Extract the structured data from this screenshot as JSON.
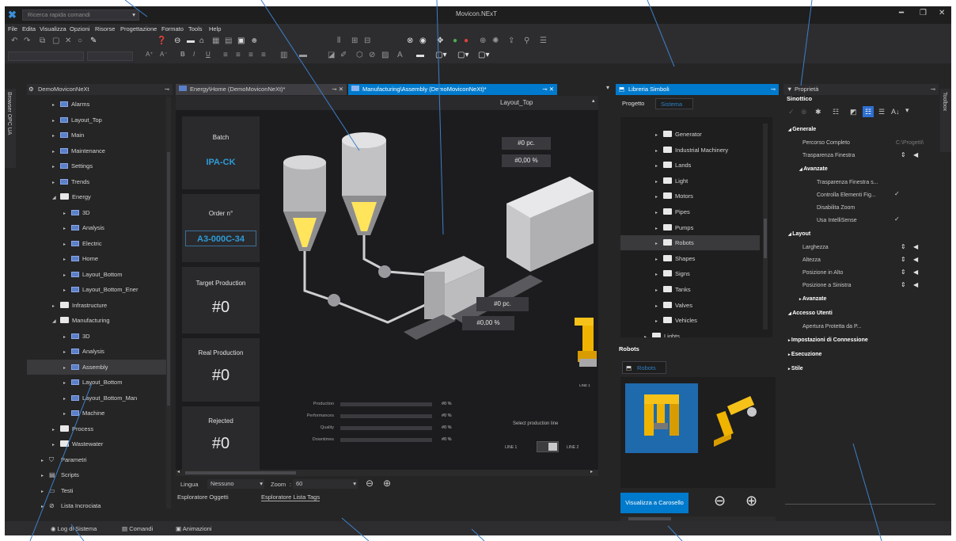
{
  "window": {
    "title": "Movicon.NExT",
    "quick_command_placeholder": "Ricerca rapida comandi"
  },
  "menu": [
    "File",
    "Edita",
    "Visualizza",
    "Opzioni",
    "Risorse",
    "Progettazione",
    "Formato",
    "Tools",
    "Help"
  ],
  "side_vertical_tabs": {
    "left": "Browser OPC UA",
    "right": "Toolbox"
  },
  "project_explorer": {
    "title": "DemoMoviconNeXt",
    "items": [
      {
        "label": "Alarms",
        "level": 1,
        "type": "screen"
      },
      {
        "label": "Layout_Top",
        "level": 1,
        "type": "screen"
      },
      {
        "label": "Main",
        "level": 1,
        "type": "screen"
      },
      {
        "label": "Maintenance",
        "level": 1,
        "type": "screen"
      },
      {
        "label": "Settings",
        "level": 1,
        "type": "screen"
      },
      {
        "label": "Trends",
        "level": 1,
        "type": "screen"
      },
      {
        "label": "Energy",
        "level": 1,
        "type": "folder-open"
      },
      {
        "label": "3D",
        "level": 2,
        "type": "screen"
      },
      {
        "label": "Analysis",
        "level": 2,
        "type": "screen"
      },
      {
        "label": "Electric",
        "level": 2,
        "type": "screen"
      },
      {
        "label": "Home",
        "level": 2,
        "type": "screen"
      },
      {
        "label": "Layout_Bottom",
        "level": 2,
        "type": "screen"
      },
      {
        "label": "Layout_Bottom_Ener",
        "level": 2,
        "type": "screen"
      },
      {
        "label": "Infrastructure",
        "level": 1,
        "type": "folder"
      },
      {
        "label": "Manufacturing",
        "level": 1,
        "type": "folder-open"
      },
      {
        "label": "3D",
        "level": 2,
        "type": "screen"
      },
      {
        "label": "Analysis",
        "level": 2,
        "type": "screen"
      },
      {
        "label": "Assembly",
        "level": 2,
        "type": "screen",
        "selected": true
      },
      {
        "label": "Layout_Bottom",
        "level": 2,
        "type": "screen"
      },
      {
        "label": "Layout_Bottom_Man",
        "level": 2,
        "type": "screen"
      },
      {
        "label": "Machine",
        "level": 2,
        "type": "screen"
      },
      {
        "label": "Process",
        "level": 1,
        "type": "folder"
      },
      {
        "label": "Wastewater",
        "level": 1,
        "type": "folder"
      },
      {
        "label": "Parametri",
        "level": 0,
        "type": "param"
      },
      {
        "label": "Scripts",
        "level": 0,
        "type": "script"
      },
      {
        "label": "Testi",
        "level": 0,
        "type": "text"
      },
      {
        "label": "Lista Incrociata",
        "level": 0,
        "type": "cross"
      }
    ]
  },
  "doc_tabs": [
    {
      "label": "Energy\\Home (DemoMoviconNeXt)*",
      "active": false
    },
    {
      "label": "Manufacturing\\Assembly (DemoMoviconNeXt)*",
      "active": true
    }
  ],
  "screen": {
    "header": "Layout_Top",
    "batch_label": "Batch",
    "batch_value": "IPA-CK",
    "order_label": "Order n°",
    "order_value": "A3-000C-34",
    "target_label": "Target Production",
    "target_value": "#0",
    "real_label": "Real Production",
    "real_value": "#0",
    "rejected_label": "Rejected",
    "rejected_value": "#0",
    "top_pc": "#0  pc.",
    "top_pct": "#0,00  %",
    "mid_pc": "#0  pc.",
    "mid_pct": "#0,00  %",
    "kpis": [
      {
        "label": "Production",
        "value": "#0  %"
      },
      {
        "label": "Performances",
        "value": "#0  %"
      },
      {
        "label": "Quality",
        "value": "#0  %"
      },
      {
        "label": "Downtimes",
        "value": "#0  %"
      }
    ],
    "select_line_label": "Select production line",
    "line1": "LINE 1",
    "line2": "LINE 2",
    "robot_caption": "LINE 1"
  },
  "canvas_footer": {
    "language_label": "Lingua",
    "language_value": "Nessuno",
    "zoom_label": "Zoom",
    "zoom_value": "60"
  },
  "object_tabs": [
    "Esploratore Oggetti",
    "Esploratore Lista Tags"
  ],
  "symbols": {
    "title": "Libreria Simboli",
    "tabs": [
      "Progetto",
      "Sistema"
    ],
    "items": [
      "Generator",
      "Industrial Machinery",
      "Lands",
      "Light",
      "Motors",
      "Pipes",
      "Pumps",
      "Robots",
      "Shapes",
      "Signs",
      "Tanks",
      "Valves",
      "Vehicles",
      "Lights"
    ],
    "selected": "Robots",
    "preview_title": "Robots",
    "preview_tab": "Robots",
    "carousel_button": "Visualizza a Carosello"
  },
  "properties": {
    "title": "Proprietà",
    "object": "Sinottico",
    "sections": [
      {
        "title": "Generale",
        "rows": [
          {
            "label": "Percorso Completo",
            "value": "C:\\Progetti\\"
          },
          {
            "label": "Trasparenza Finestra",
            "value": ""
          }
        ]
      },
      {
        "title": "Avanzate",
        "rows": [
          {
            "label": "Trasparenza Finestra s...",
            "value": ""
          },
          {
            "label": "Controlla Elementi Fig...",
            "value": "✓"
          },
          {
            "label": "Disabilita Zoom",
            "value": ""
          },
          {
            "label": "Usa IntelliSense",
            "value": "✓"
          }
        ]
      },
      {
        "title": "Layout",
        "rows": [
          {
            "label": "Larghezza",
            "value": ""
          },
          {
            "label": "Altezza",
            "value": ""
          },
          {
            "label": "Posizione in Alto",
            "value": ""
          },
          {
            "label": "Posizione a Sinistra",
            "value": ""
          }
        ]
      },
      {
        "title": "Avanzate",
        "rows": []
      },
      {
        "title": "Accesso Utenti",
        "rows": [
          {
            "label": "Apertura Protetta da P...",
            "value": ""
          }
        ]
      },
      {
        "title": "Impostazioni di Connessione",
        "rows": []
      },
      {
        "title": "Esecuzione",
        "rows": []
      },
      {
        "title": "Stile",
        "rows": []
      }
    ]
  },
  "bottom_tabs": [
    "Log di Sistema",
    "Comandi",
    "Animazioni"
  ],
  "colors": {
    "accent": "#007acc",
    "cyan_value": "#2e9bd6",
    "robot_yellow": "#f0b400",
    "leader": "#3d7fc6"
  }
}
